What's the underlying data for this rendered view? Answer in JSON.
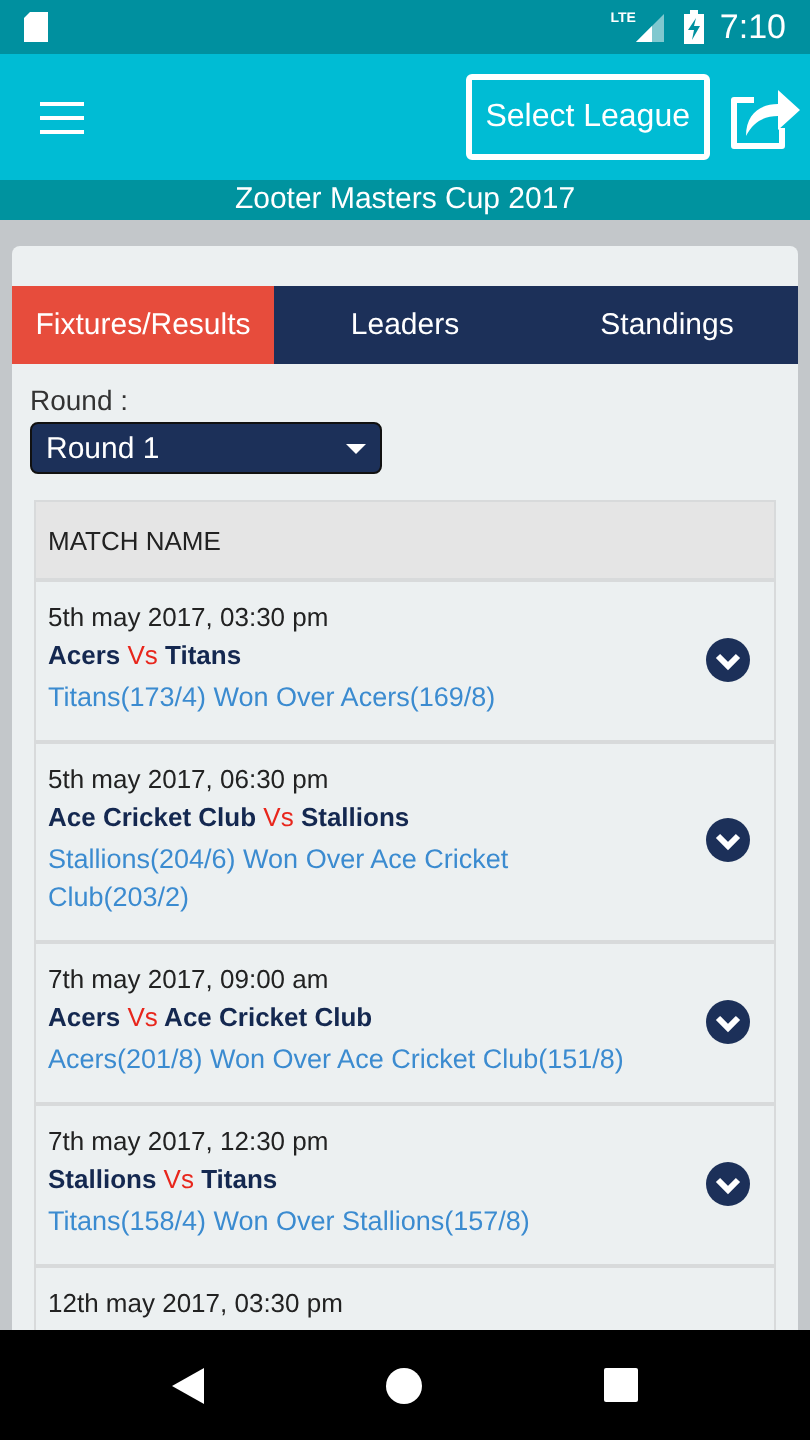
{
  "status_bar": {
    "network": "LTE",
    "time": "7:10"
  },
  "app_bar": {
    "league_button": "Select League"
  },
  "title": "Zooter Masters Cup 2017",
  "tabs": [
    {
      "label": "Fixtures/Results",
      "selected": true
    },
    {
      "label": "Leaders",
      "selected": false
    },
    {
      "label": "Standings",
      "selected": false
    }
  ],
  "round": {
    "label": "Round :",
    "value": "Round 1"
  },
  "table": {
    "header": "MATCH NAME",
    "rows": [
      {
        "datetime": "5th may 2017, 03:30 pm",
        "team_a": "Acers",
        "vs": "Vs",
        "team_b": "Titans",
        "result": "Titans(173/4) Won Over Acers(169/8)"
      },
      {
        "datetime": "5th may 2017, 06:30 pm",
        "team_a": "Ace Cricket Club",
        "vs": "Vs",
        "team_b": "Stallions",
        "result": "Stallions(204/6) Won Over Ace Cricket Club(203/2)"
      },
      {
        "datetime": "7th may 2017, 09:00 am",
        "team_a": "Acers",
        "vs": "Vs",
        "team_b": "Ace Cricket Club",
        "result": "Acers(201/8) Won Over Ace Cricket Club(151/8)"
      },
      {
        "datetime": "7th may 2017, 12:30 pm",
        "team_a": "Stallions",
        "vs": "Vs",
        "team_b": "Titans",
        "result": "Titans(158/4) Won Over Stallions(157/8)"
      },
      {
        "datetime": "12th may 2017, 03:30 pm"
      }
    ]
  }
}
